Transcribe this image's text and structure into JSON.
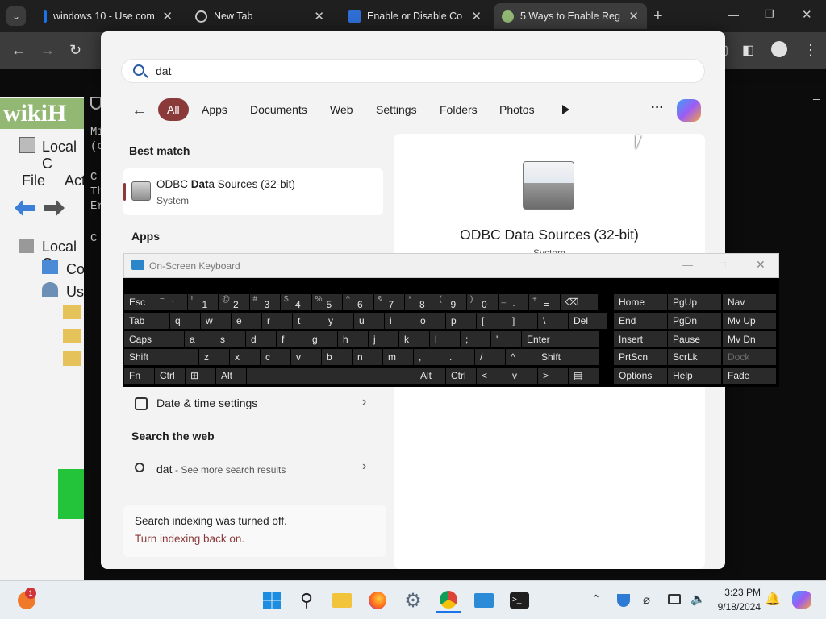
{
  "browser": {
    "tabs": [
      {
        "title": "windows 10 - Use com",
        "active": false
      },
      {
        "title": "New Tab",
        "active": false
      },
      {
        "title": "Enable or Disable Co",
        "active": false
      },
      {
        "title": "5 Ways to Enable Reg",
        "active": true
      }
    ],
    "new_tab": "+",
    "window_controls": {
      "minimize": "—",
      "restore": "❐",
      "close": "✕"
    }
  },
  "background_mmc": {
    "logo": "wikiH",
    "title": "Local C",
    "menu_file": "File",
    "menu_action": "Act",
    "tree_root": "Local C",
    "tree_co": "Co",
    "tree_us": "Us"
  },
  "background_cmd": {
    "lines": [
      "Mi",
      "(c",
      "C",
      "Th",
      "Er",
      "C"
    ]
  },
  "start": {
    "search": {
      "value": "dat"
    },
    "filters": [
      "All",
      "Apps",
      "Documents",
      "Web",
      "Settings",
      "Folders",
      "Photos"
    ],
    "more_label": "···",
    "best_match_header": "Best match",
    "best_match": {
      "title_pre": "ODBC ",
      "title_bold": "Dat",
      "title_post": "a Sources (32-bit)",
      "subtitle": "System"
    },
    "apps_header": "Apps",
    "settings_item": "Date & time settings",
    "search_web_header": "Search the web",
    "web_item": {
      "query": "dat",
      "hint": " - See more search results"
    },
    "indexing": {
      "message": "Search indexing was turned off.",
      "link": "Turn indexing back on."
    },
    "detail": {
      "title": "ODBC Data Sources (32-bit)",
      "subtitle": "System"
    }
  },
  "osk": {
    "title": "On-Screen Keyboard",
    "row1": [
      {
        "main": "Esc"
      },
      {
        "top": "~",
        "bot": "`"
      },
      {
        "top": "!",
        "bot": "1"
      },
      {
        "top": "@",
        "bot": "2"
      },
      {
        "top": "#",
        "bot": "3"
      },
      {
        "top": "$",
        "bot": "4"
      },
      {
        "top": "%",
        "bot": "5"
      },
      {
        "top": "^",
        "bot": "6"
      },
      {
        "top": "&",
        "bot": "7"
      },
      {
        "top": "*",
        "bot": "8"
      },
      {
        "top": "(",
        "bot": "9"
      },
      {
        "top": ")",
        "bot": "0"
      },
      {
        "top": "_",
        "bot": "-"
      },
      {
        "top": "+",
        "bot": "="
      },
      {
        "main": "⌫"
      }
    ],
    "row2": [
      "Tab",
      "q",
      "w",
      "e",
      "r",
      "t",
      "y",
      "u",
      "i",
      "o",
      "p",
      "[",
      "]",
      "\\",
      "Del"
    ],
    "row3": [
      "Caps",
      "a",
      "s",
      "d",
      "f",
      "g",
      "h",
      "j",
      "k",
      "l",
      ";",
      "'",
      "Enter"
    ],
    "row4": [
      "Shift",
      "z",
      "x",
      "c",
      "v",
      "b",
      "n",
      "m",
      ",",
      ".",
      "/",
      "^",
      "Shift"
    ],
    "row5": [
      "Fn",
      "Ctrl",
      "⊞",
      "Alt",
      "",
      "Alt",
      "Ctrl",
      "<",
      "v",
      ">",
      "▤"
    ],
    "nav": [
      [
        "Home",
        "PgUp",
        "Nav"
      ],
      [
        "End",
        "PgDn",
        "Mv Up"
      ],
      [
        "Insert",
        "Pause",
        "Mv Dn"
      ],
      [
        "PrtScn",
        "ScrLk",
        "Dock"
      ],
      [
        "Options",
        "Help",
        "Fade"
      ]
    ]
  },
  "taskbar": {
    "time": "3:23 PM",
    "date": "9/18/2024",
    "badge": "1"
  },
  "colors": {
    "accent": "#8b3a3a",
    "link": "#8b3a3a"
  }
}
